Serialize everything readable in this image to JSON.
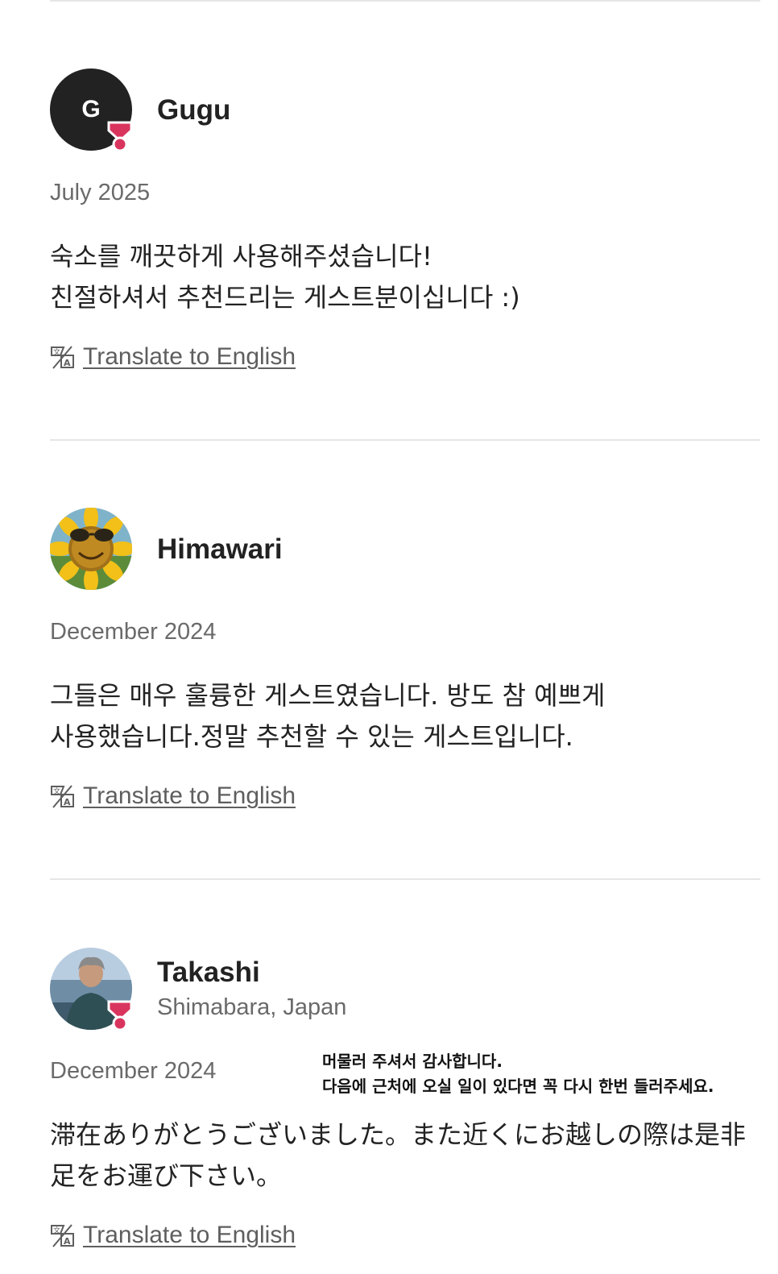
{
  "reviews": [
    {
      "avatar_letter": "G",
      "avatar_type": "letter",
      "has_badge": true,
      "name": "Gugu",
      "date": "July 2025",
      "text": "숙소를 깨끗하게 사용해주셨습니다!\n친절하셔서 추천드리는 게스트분이십니다 :)",
      "translate_label": "Translate to English"
    },
    {
      "avatar_type": "photo-sunflower",
      "has_badge": false,
      "name": "Himawari",
      "date": "December 2024",
      "text": "그들은 매우 훌륭한 게스트였습니다. 방도 참 예쁘게\n사용했습니다.정말 추천할 수 있는 게스트입니다.",
      "translate_label": "Translate to English"
    },
    {
      "avatar_type": "photo-person",
      "has_badge": true,
      "name": "Takashi",
      "location": "Shimabara, Japan",
      "date": "December 2024",
      "text": "滞在ありがとうございました。また近くにお越しの際は是非\n足をお運び下さい。",
      "translate_label": "Translate to English"
    }
  ],
  "overlay_note": "머물러 주셔서 감사합니다.\n다음에 근처에 오실 일이 있다면 꼭 다시 한번 들러주세요.",
  "colors": {
    "text_primary": "#222222",
    "text_secondary": "#6a6a6a",
    "badge": "#d9345e",
    "divider": "#e6e6e6"
  },
  "icons": {
    "badge": "superhost-badge-icon",
    "translate": "translate-icon"
  }
}
